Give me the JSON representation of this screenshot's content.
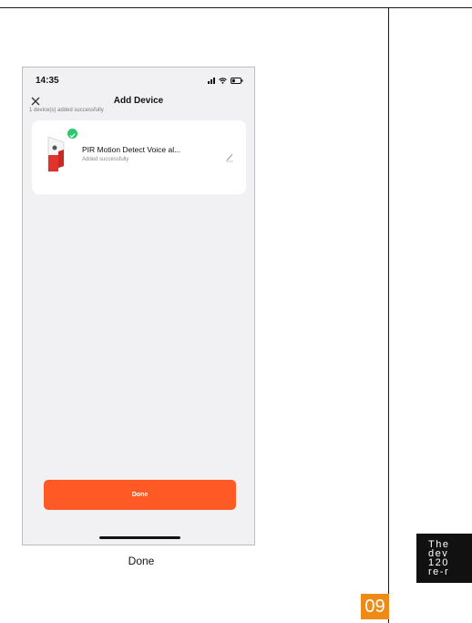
{
  "status_bar": {
    "time": "14:35"
  },
  "nav": {
    "title": "Add Device"
  },
  "summary": {
    "added_text": "1 device(s) added successfully"
  },
  "device": {
    "name": "PIR Motion Detect Voice al...",
    "status": "Added successfully"
  },
  "actions": {
    "done_label": "Done"
  },
  "caption": "Done",
  "page_number": "09",
  "side_note": {
    "text": "The\ndev\n120\nre-r"
  },
  "colors": {
    "accent": "#ff5a26",
    "success": "#2dc76d",
    "page_badge": "#ee8b17"
  }
}
